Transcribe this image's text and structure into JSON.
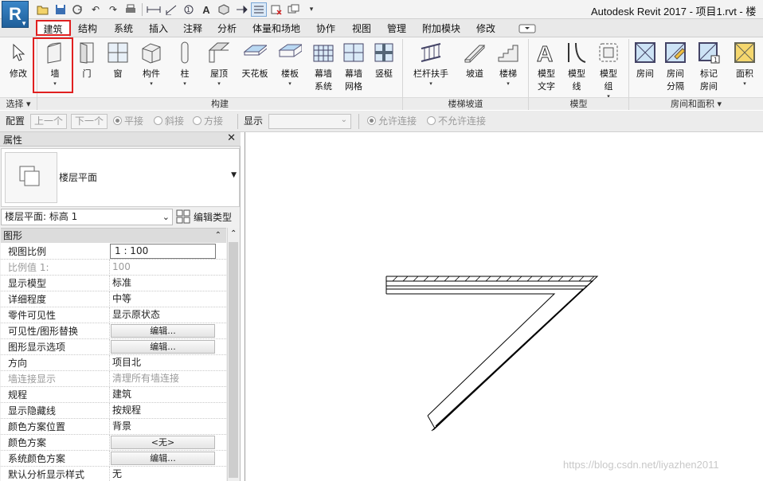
{
  "title": "Autodesk Revit 2017 -    项目1.rvt - 楼",
  "app_logo": "R",
  "tabs": [
    {
      "label": "建筑"
    },
    {
      "label": "结构"
    },
    {
      "label": "系统"
    },
    {
      "label": "插入"
    },
    {
      "label": "注释"
    },
    {
      "label": "分析"
    },
    {
      "label": "体量和场地"
    },
    {
      "label": "协作"
    },
    {
      "label": "视图"
    },
    {
      "label": "管理"
    },
    {
      "label": "附加模块"
    },
    {
      "label": "修改"
    }
  ],
  "ribbon": {
    "buttons": [
      {
        "label": "修改",
        "icon": "cursor-icon"
      },
      {
        "label": "墙",
        "icon": "wall-icon",
        "dropdown": "▾"
      },
      {
        "label": "门",
        "icon": "door-icon"
      },
      {
        "label": "窗",
        "icon": "window-icon"
      },
      {
        "label": "构件",
        "icon": "component-icon",
        "dropdown": "▾"
      },
      {
        "label": "柱",
        "icon": "column-icon",
        "dropdown": "▾"
      },
      {
        "label": "屋顶",
        "icon": "roof-icon",
        "dropdown": "▾"
      },
      {
        "label": "天花板",
        "icon": "ceiling-icon"
      },
      {
        "label": "楼板",
        "icon": "floor-icon",
        "dropdown": "▾"
      },
      {
        "label": "幕墙\n系统",
        "icon": "curtain-system-icon"
      },
      {
        "label": "幕墙\n网格",
        "icon": "curtain-grid-icon"
      },
      {
        "label": "竖梃",
        "icon": "mullion-icon"
      },
      {
        "label": "栏杆扶手",
        "icon": "railing-icon",
        "dropdown": "▾"
      },
      {
        "label": "坡道",
        "icon": "ramp-icon"
      },
      {
        "label": "楼梯",
        "icon": "stair-icon",
        "dropdown": "▾"
      },
      {
        "label": "模型\n文字",
        "icon": "model-text-icon"
      },
      {
        "label": "模型\n线",
        "icon": "model-line-icon"
      },
      {
        "label": "模型\n组",
        "icon": "model-group-icon",
        "dropdown": "▾"
      },
      {
        "label": "房间",
        "icon": "room-icon"
      },
      {
        "label": "房间\n分隔",
        "icon": "room-separator-icon"
      },
      {
        "label": "标记\n房间",
        "icon": "tag-room-icon",
        "dropdown": "▾"
      },
      {
        "label": "面积",
        "icon": "area-icon",
        "dropdown": "▾"
      }
    ],
    "panels": [
      {
        "label": "选择 ▾"
      },
      {
        "label": "构建"
      },
      {
        "label": "楼梯坡道"
      },
      {
        "label": "模型"
      },
      {
        "label": "房间和面积 ▾"
      }
    ]
  },
  "options_bar": {
    "label_config": "配置",
    "prev": "上一个",
    "next": "下一个",
    "radio1": "平接",
    "radio2": "斜接",
    "radio3": "方接",
    "label_display": "显示",
    "allow": "允许连接",
    "disallow": "不允许连接"
  },
  "properties": {
    "title": "属性",
    "type_name": "楼层平面",
    "instance": "楼层平面: 标高 1",
    "edit_type": "编辑类型",
    "group": "图形",
    "rows": [
      {
        "name": "视图比例",
        "value": "1 : 100",
        "kind": "input"
      },
      {
        "name": "比例值 1:",
        "value": "100",
        "kind": "dis"
      },
      {
        "name": "显示模型",
        "value": "标准"
      },
      {
        "name": "详细程度",
        "value": "中等"
      },
      {
        "name": "零件可见性",
        "value": "显示原状态"
      },
      {
        "name": "可见性/图形替换",
        "value": "编辑...",
        "kind": "btn"
      },
      {
        "name": "图形显示选项",
        "value": "编辑...",
        "kind": "btn"
      },
      {
        "name": "方向",
        "value": "项目北"
      },
      {
        "name": "墙连接显示",
        "value": "清理所有墙连接",
        "kind": "dis"
      },
      {
        "name": "规程",
        "value": "建筑"
      },
      {
        "name": "显示隐藏线",
        "value": "按规程"
      },
      {
        "name": "颜色方案位置",
        "value": "背景"
      },
      {
        "name": "颜色方案",
        "value": "<无>",
        "kind": "btn"
      },
      {
        "name": "系统颜色方案",
        "value": "编辑...",
        "kind": "btn"
      },
      {
        "name": "默认分析显示样式",
        "value": "无"
      }
    ]
  },
  "watermark": "https://blog.csdn.net/liyazhen2011"
}
